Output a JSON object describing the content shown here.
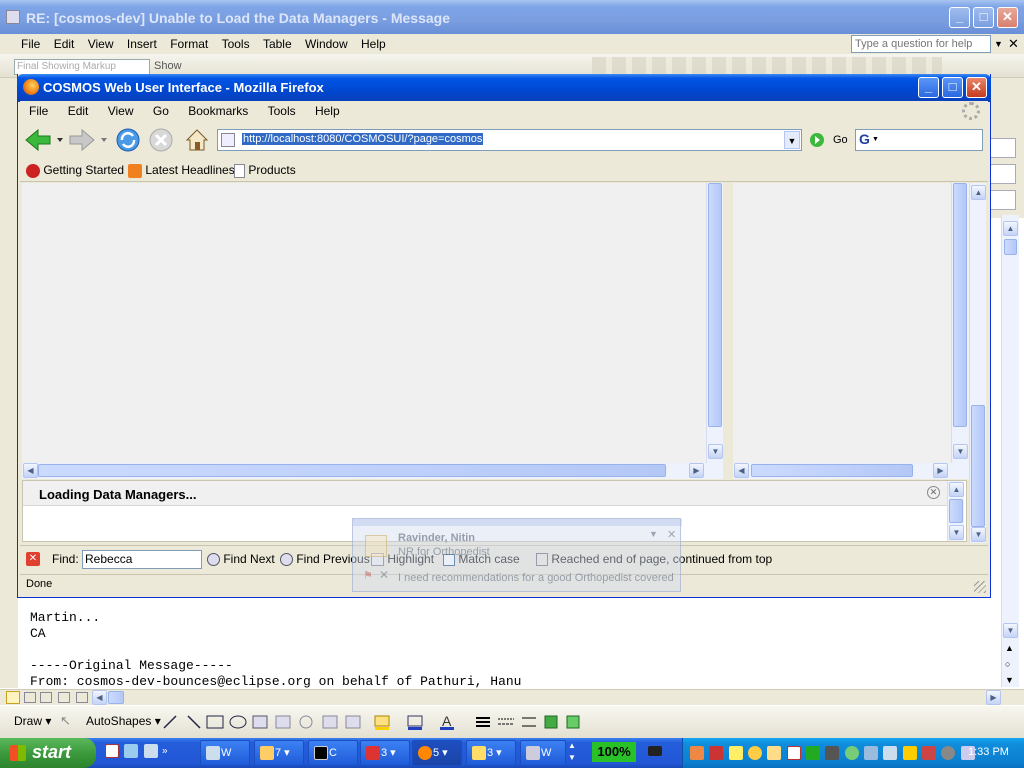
{
  "word": {
    "title": "RE: [cosmos-dev] Unable to Load the Data Managers - Message",
    "menu": [
      "File",
      "Edit",
      "View",
      "Insert",
      "Format",
      "Tools",
      "Table",
      "Window",
      "Help"
    ],
    "help_placeholder": "Type a question for help",
    "markup_select": "Final Showing Markup",
    "show_label": "Show",
    "body_lines": [
      "Martin...",
      "CA",
      "",
      "-----Original Message-----",
      "From: cosmos-dev-bounces@eclipse.org on behalf of Pathuri, Hanu"
    ],
    "draw_label": "Draw",
    "autoshapes_label": "AutoShapes"
  },
  "firefox": {
    "title": "COSMOS Web User Interface - Mozilla Firefox",
    "menu": [
      "File",
      "Edit",
      "View",
      "Go",
      "Bookmarks",
      "Tools",
      "Help"
    ],
    "url": "http://localhost:8080/COSMOSUI/?page=cosmos",
    "go_label": "Go",
    "search_value": "",
    "bookmarks": [
      "Getting Started",
      "Latest Headlines",
      "Products"
    ],
    "loading_text": "Loading Data Managers...",
    "find": {
      "label": "Find:",
      "value": "Rebecca",
      "next": "Find Next",
      "previous": "Find Previous",
      "highlight": "Highlight",
      "match_case": "Match case",
      "status": "Reached end of page, continued from top"
    },
    "status": "Done"
  },
  "notification": {
    "sender": "Ravinder, Nitin",
    "subject": "NR for Orthopedist",
    "preview": "I need recommendations for a good Orthopedist covered"
  },
  "taskbar": {
    "start_label": "start",
    "zoom": "100%",
    "tasks": [
      {
        "label": "W"
      },
      {
        "label": "7"
      },
      {
        "label": "C"
      },
      {
        "label": "3"
      },
      {
        "label": "5"
      },
      {
        "label": "3"
      },
      {
        "label": "W"
      }
    ],
    "clock": "1:33 PM"
  },
  "colors": {
    "xp_blue": "#0055e5",
    "start_green": "#3c9a3c",
    "zoom_green": "#28c228"
  }
}
